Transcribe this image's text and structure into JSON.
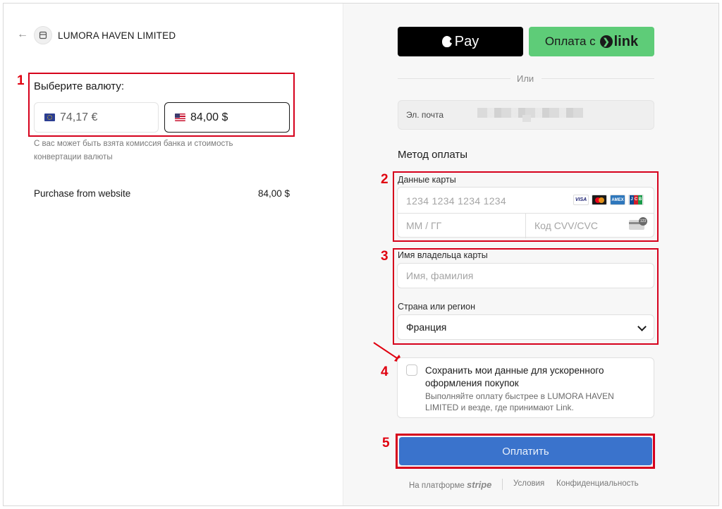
{
  "merchant": {
    "back_icon": "arrow-left-icon",
    "shop_icon": "store-icon",
    "name": "LUMORA HAVEN LIMITED"
  },
  "currency": {
    "title": "Выберите валюту:",
    "options": [
      {
        "flag": "eu-flag-icon",
        "label": "74,17 €"
      },
      {
        "flag": "us-flag-icon",
        "label": "84,00 $",
        "selected": true
      }
    ],
    "note": "С вас может быть взята комиссия банка и стоимость конвертации валюты"
  },
  "summary": {
    "item": "Purchase from website",
    "amount": "84,00 $"
  },
  "express": {
    "apple_pay_label": "Pay",
    "link_prefix": "Оплата с",
    "link_brand": "link",
    "divider": "Или"
  },
  "email": {
    "label": "Эл. почта"
  },
  "payment": {
    "title": "Метод оплаты",
    "card_label": "Данные карты",
    "card_number_placeholder": "1234 1234 1234 1234",
    "expiry_placeholder": "ММ / ГГ",
    "cvc_placeholder": "Код CVV/CVC",
    "brands": {
      "visa": "VISA",
      "amex": "AMEX",
      "jcb": [
        "J",
        "C",
        "B"
      ],
      "cvc_badge": "123"
    },
    "holder_label": "Имя владельца карты",
    "holder_placeholder": "Имя, фамилия",
    "country_label": "Страна или регион",
    "country_value": "Франция"
  },
  "save": {
    "title": "Сохранить мои данные для ускоренного оформления покупок",
    "description": "Выполняйте оплату быстрее в LUMORA HAVEN LIMITED и везде, где принимают Link."
  },
  "pay_button": "Оплатить",
  "footer": {
    "powered_prefix": "На платформе",
    "powered_brand": "stripe",
    "terms": "Условия",
    "privacy": "Конфиденциальность"
  },
  "annotations": [
    "1",
    "2",
    "3",
    "4",
    "5"
  ],
  "colors": {
    "annotation_red": "#d6001c",
    "pay_button": "#3a73cc",
    "link_green": "#5ecc78"
  }
}
